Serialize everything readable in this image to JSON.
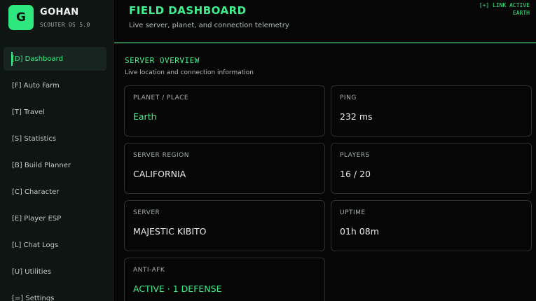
{
  "brand": {
    "logo_letter": "G",
    "title": "GOHAN",
    "subtitle": "SCOUTER OS 5.0"
  },
  "nav": {
    "items": [
      {
        "label": "[D] Dashboard",
        "active": true
      },
      {
        "label": "[F] Auto Farm"
      },
      {
        "label": "[T] Travel"
      },
      {
        "label": "[S] Statistics"
      },
      {
        "label": "[B] Build Planner"
      },
      {
        "label": "[C] Character"
      },
      {
        "label": "[E] Player ESP"
      },
      {
        "label": "[L] Chat Logs"
      },
      {
        "label": "[U] Utilities"
      },
      {
        "label": "[=] Settings"
      }
    ]
  },
  "header": {
    "title": "FIELD DASHBOARD",
    "subtitle": "Live server, planet, and connection telemetry",
    "status_line1": "[+] LINK ACTIVE",
    "status_line2": "EARTH"
  },
  "section": {
    "title": "SERVER OVERVIEW",
    "subtitle": "Live location and connection information"
  },
  "cards": {
    "planet": {
      "label": "PLANET / PLACE",
      "value": "Earth"
    },
    "ping": {
      "label": "PING",
      "value": "232 ms"
    },
    "region": {
      "label": "SERVER REGION",
      "value": "CALIFORNIA"
    },
    "players": {
      "label": "PLAYERS",
      "value": "16 / 20"
    },
    "server": {
      "label": "SERVER",
      "value": "MAJESTIC KIBITO"
    },
    "uptime": {
      "label": "UPTIME",
      "value": "01h 08m"
    },
    "antiafk": {
      "label": "ANTI-AFK",
      "value": "ACTIVE · 1 DEFENSE"
    }
  },
  "colors": {
    "accent": "#3ff08c",
    "background": "#050605",
    "sidebar": "#0e1512"
  }
}
